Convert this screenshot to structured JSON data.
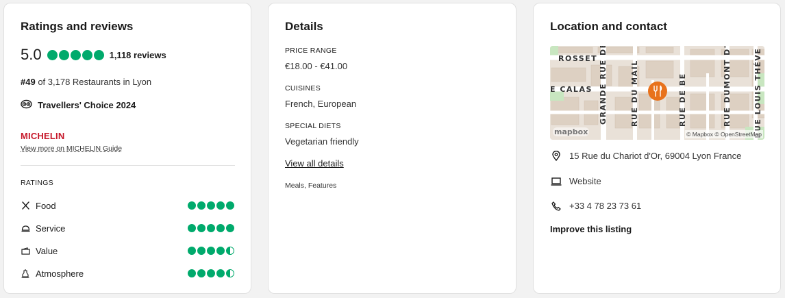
{
  "ratings_card": {
    "title": "Ratings and reviews",
    "score": "5.0",
    "overall_rating": 5.0,
    "reviews": "1,118 reviews",
    "rank_number": "#49",
    "rank_text": " of 3,178 Restaurants in Lyon",
    "award": "Travellers' Choice 2024",
    "michelin": "MICHELIN",
    "michelin_link": "View more on MICHELIN Guide",
    "ratings_heading": "RATINGS",
    "ratings": [
      {
        "label": "Food",
        "icon": "fork-knife-icon",
        "value": 5.0
      },
      {
        "label": "Service",
        "icon": "cloche-icon",
        "value": 5.0
      },
      {
        "label": "Value",
        "icon": "wallet-icon",
        "value": 4.5
      },
      {
        "label": "Atmosphere",
        "icon": "cocktail-icon",
        "value": 4.5
      }
    ]
  },
  "details_card": {
    "title": "Details",
    "sections": [
      {
        "label": "PRICE RANGE",
        "value": "€18.00 - €41.00"
      },
      {
        "label": "CUISINES",
        "value": "French, European"
      },
      {
        "label": "SPECIAL DIETS",
        "value": "Vegetarian friendly"
      }
    ],
    "view_all": "View all details",
    "meals": "Meals, Features"
  },
  "location_card": {
    "title": "Location and contact",
    "map": {
      "streets": [
        "ROSSET",
        "GRANDE RUE DE",
        "RUE DU MAIL",
        "RUE DE BE",
        "RUE DUMONT D'",
        "RUE LOUIS THÉVE",
        "E CALAS"
      ],
      "attribution": "© Mapbox © OpenStreetMap",
      "logo": "mapbox"
    },
    "address": "15 Rue du Chariot d'Or, 69004 Lyon France",
    "website": "Website",
    "phone": "+33 4 78 23 73 61",
    "improve": "Improve this listing"
  },
  "colors": {
    "bubble_green": "#00aa6c",
    "michelin_red": "#c6182a",
    "map_pin": "#e8721c",
    "background": "#f2f2f2"
  }
}
